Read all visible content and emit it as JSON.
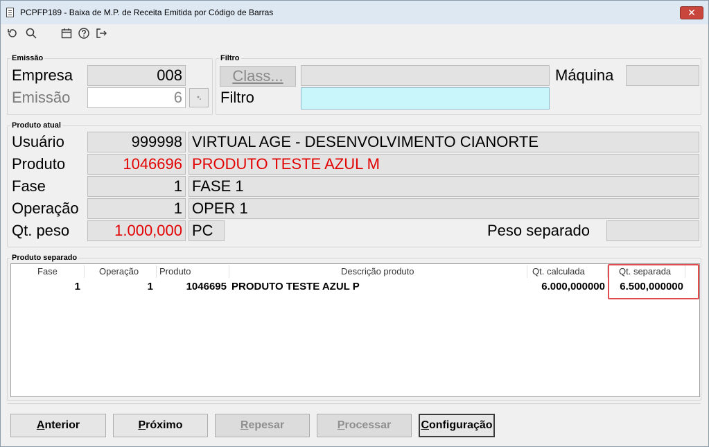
{
  "window": {
    "title": "PCPFP189 - Baixa de M.P. de Receita Emitida por Código de Barras",
    "close_glyph": "✕"
  },
  "toolbar": {
    "icons": [
      "refresh-icon",
      "search-icon",
      "calendar-icon",
      "help-icon",
      "exit-icon"
    ]
  },
  "emissao": {
    "legend": "Emissão",
    "empresa_label": "Empresa",
    "empresa_value": "008",
    "emissao_label": "Emissão",
    "emissao_value": "6"
  },
  "filtro": {
    "legend": "Filtro",
    "class_button_label": "Class...",
    "class_value": "",
    "maquina_label": "Máquina",
    "maquina_value": "",
    "filtro_label": "Filtro",
    "filtro_value": ""
  },
  "produto_atual": {
    "legend": "Produto atual",
    "usuario_label": "Usuário",
    "usuario_code": "999998",
    "usuario_name": "VIRTUAL AGE - DESENVOLVIMENTO CIANORTE",
    "produto_label": "Produto",
    "produto_code": "1046696",
    "produto_name": "PRODUTO TESTE AZUL M",
    "fase_label": "Fase",
    "fase_code": "1",
    "fase_name": "FASE 1",
    "operacao_label": "Operação",
    "operacao_code": "1",
    "operacao_name": "OPER 1",
    "qtpeso_label": "Qt. peso",
    "qtpeso_value": "1.000,000",
    "qtpeso_unit": "PC",
    "peso_separado_label": "Peso separado",
    "peso_separado_value": ""
  },
  "produto_separado": {
    "legend": "Produto separado",
    "columns": [
      "Fase",
      "Operação",
      "Produto",
      "Descrição produto",
      "Qt. calculada",
      "Qt. separada"
    ],
    "rows": [
      {
        "fase": "1",
        "operacao": "1",
        "produto": "1046695",
        "descricao": "PRODUTO TESTE AZUL P",
        "qt_calculada": "6.000,000000",
        "qt_separada": "6.500,000000"
      }
    ]
  },
  "buttons": {
    "anterior_first": "A",
    "anterior_rest": "nterior",
    "proximo_first": "P",
    "proximo_rest": "róximo",
    "repesar_first": "R",
    "repesar_rest": "epesar",
    "processar_first": "P",
    "processar_rest": "rocessar",
    "configuracao_first": "C",
    "configuracao_rest": "onfiguração"
  },
  "colors": {
    "highlight_red": "#e30000",
    "filter_cyan": "#c9f6fb",
    "selection_box": "#e14b4b"
  }
}
